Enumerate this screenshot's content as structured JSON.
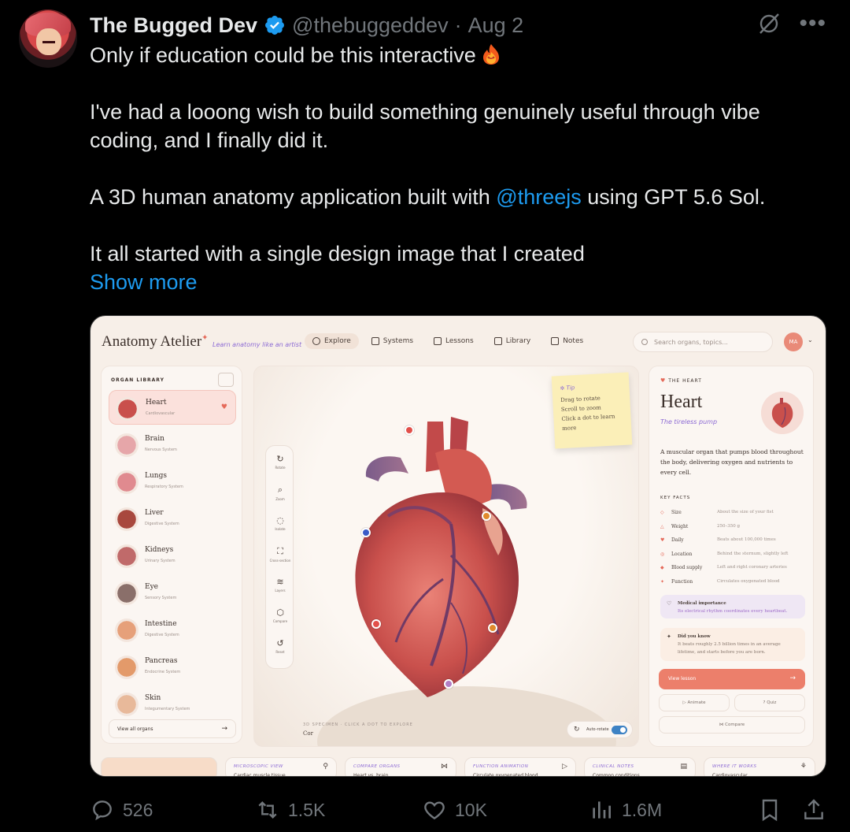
{
  "tweet": {
    "author_name": "The Bugged Dev",
    "handle": "@thebuggeddev",
    "separator": "·",
    "date": "Aug 2",
    "line1": "Only if education could be this interactive",
    "line2": "I've had a looong wish to build something genuinely useful through vibe coding, and I finally did it.",
    "line3_pre": "A 3D human anatomy application built with ",
    "line3_mention": "@threejs",
    "line3_post": " using GPT 5.6 Sol.",
    "line4": "It all started with a single design image that I created",
    "show_more": "Show more"
  },
  "icons": {
    "verified": "verified-badge-icon",
    "grok": "grok-icon",
    "more": "more-icon",
    "fire": "fire-emoji-icon"
  },
  "colors": {
    "background": "#000000",
    "text": "#e7e9ea",
    "muted": "#71767b",
    "link": "#1d9bf0",
    "verified": "#1d9bf0"
  },
  "app": {
    "brand": "Anatomy Atelier",
    "tagline": "Learn anatomy like an artist",
    "nav": [
      "Explore",
      "Systems",
      "Lessons",
      "Library",
      "Notes"
    ],
    "search_placeholder": "Search organs, topics...",
    "user_initials": "MA",
    "library_title": "ORGAN LIBRARY",
    "organs": [
      {
        "name": "Heart",
        "system": "Cardiovascular"
      },
      {
        "name": "Brain",
        "system": "Nervous System"
      },
      {
        "name": "Lungs",
        "system": "Respiratory System"
      },
      {
        "name": "Liver",
        "system": "Digestive System"
      },
      {
        "name": "Kidneys",
        "system": "Urinary System"
      },
      {
        "name": "Eye",
        "system": "Sensory System"
      },
      {
        "name": "Intestine",
        "system": "Digestive System"
      },
      {
        "name": "Pancreas",
        "system": "Endocrine System"
      },
      {
        "name": "Skin",
        "system": "Integumentary System"
      }
    ],
    "view_all": "View all organs",
    "tools": [
      "Rotate",
      "Zoom",
      "Isolate",
      "Cross-section",
      "Layers",
      "Compare",
      "Reset"
    ],
    "tip": {
      "title": "Tip",
      "l1": "Drag to rotate",
      "l2": "Scroll to zoom",
      "l3": "Click a dot to learn",
      "l4": "more"
    },
    "specimen_label": "3D SPECIMEN · CLICK A DOT TO EXPLORE",
    "specimen_name": "Cor",
    "autorotate": "Auto-rotate",
    "detail": {
      "kicker": "THE HEART",
      "title": "Heart",
      "subtitle": "The tireless pump",
      "desc": "A muscular organ that pumps blood throughout the body, delivering oxygen and nutrients to every cell.",
      "facts_title": "KEY FACTS",
      "facts": [
        {
          "k": "Size",
          "v": "About the size of your fist"
        },
        {
          "k": "Weight",
          "v": "250–350 g"
        },
        {
          "k": "Daily",
          "v": "Beats about 100,000 times"
        },
        {
          "k": "Location",
          "v": "Behind the sternum, slightly left"
        },
        {
          "k": "Blood supply",
          "v": "Left and right coronary arteries"
        },
        {
          "k": "Function",
          "v": "Circulates oxygenated blood"
        }
      ],
      "medical_title": "Medical importance",
      "medical_desc": "Its electrical rhythm coordinates every heartbeat.",
      "know_title": "Did you know",
      "know_desc": "It beats roughly 2.5 billion times in an average lifetime, and starts before you are born.",
      "view_lesson": "View lesson",
      "animate": "Animate",
      "quiz": "Quiz",
      "compare": "Compare"
    },
    "strip": [
      {
        "k": "MICROSCOPIC VIEW",
        "v": "Cardiac muscle tissue"
      },
      {
        "k": "COMPARE ORGANS",
        "v": "Heart vs. brain"
      },
      {
        "k": "FUNCTION ANIMATION",
        "v": "Circulate oxygenated blood"
      },
      {
        "k": "CLINICAL NOTES",
        "v": "Common conditions"
      },
      {
        "k": "WHERE IT WORKS",
        "v": "Cardiovascular"
      }
    ]
  },
  "actions": {
    "replies": "526",
    "reposts": "1.5K",
    "likes": "10K",
    "views": "1.6M"
  }
}
